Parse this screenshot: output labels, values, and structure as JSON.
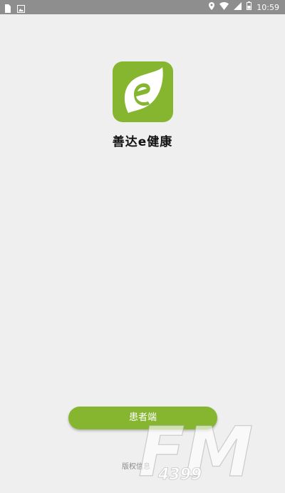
{
  "status_bar": {
    "time": "10:59",
    "icons": [
      "file-icon",
      "image-notification-icon",
      "location-icon",
      "wifi-icon",
      "signal-icon",
      "battery-icon"
    ]
  },
  "app": {
    "name": "善达e健康",
    "logo_icon": "leaf-e-logo-icon",
    "brand_color": "#86b62f"
  },
  "actions": {
    "patient_label": "患者端",
    "copyright_label": "版权信息"
  },
  "watermark": {
    "text_main": "FM",
    "text_sub": "4399"
  }
}
